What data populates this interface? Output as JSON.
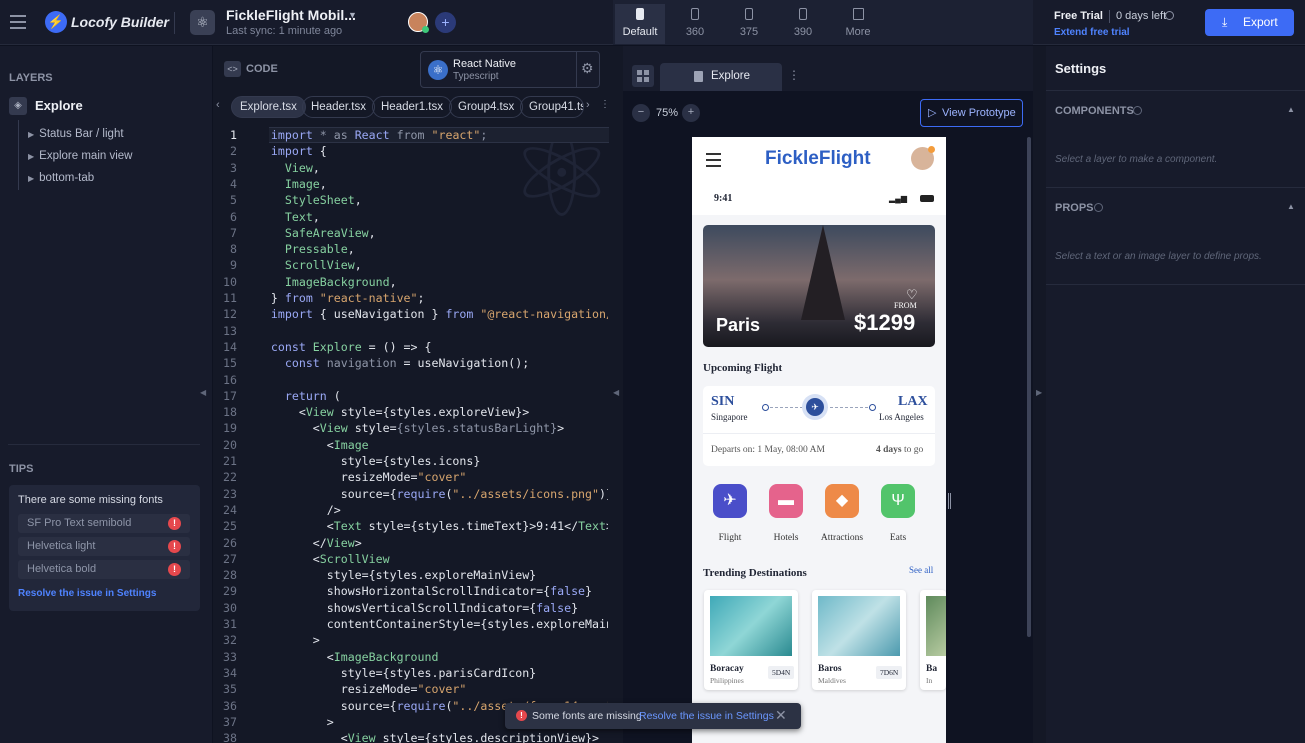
{
  "app": {
    "brand": "Locofy Builder",
    "project_title": "FickleFlight Mobil...",
    "sync_status": "Last sync: 1 minute ago",
    "add_label": "+"
  },
  "devices": [
    {
      "label": "Default"
    },
    {
      "label": "360"
    },
    {
      "label": "375"
    },
    {
      "label": "390"
    },
    {
      "label": "More"
    }
  ],
  "trial": {
    "label": "Free Trial",
    "days": "0 days left",
    "extend": "Extend free trial",
    "export": "Export"
  },
  "layers": {
    "title": "LAYERS",
    "root": "Explore",
    "items": [
      "Status Bar / light",
      "Explore main view",
      "bottom-tab"
    ]
  },
  "tips": {
    "title": "TIPS",
    "heading": "There are some missing fonts",
    "fonts": [
      "SF Pro Text semibold",
      "Helvetica light",
      "Helvetica bold"
    ],
    "resolve": "Resolve the issue in Settings"
  },
  "code": {
    "title": "CODE",
    "framework": "React Native",
    "language": "Typescript",
    "tabs": [
      "Explore.tsx",
      "Header.tsx",
      "Header1.tsx",
      "Group4.tsx",
      "Group41.ts"
    ]
  },
  "preview": {
    "tab": "Explore",
    "zoom": "75%",
    "view_prototype": "View Prototype"
  },
  "phone": {
    "logo": "FickleFlight",
    "time": "9:41",
    "hero_city": "Paris",
    "hero_from": "FROM",
    "hero_price": "$1299",
    "upcoming": "Upcoming Flight",
    "from_code": "SIN",
    "from_city": "Singapore",
    "to_code": "LAX",
    "to_city": "Los Angeles",
    "departs": "Departs on: 1 May, 08:00 AM",
    "days_num": "4 days",
    "days_suffix": "to go",
    "categories": [
      "Flight",
      "Hotels",
      "Attractions",
      "Eats"
    ],
    "trending": "Trending Destinations",
    "see_all": "See all",
    "destinations": [
      {
        "name": "Boracay",
        "country": "Philippines",
        "badge": "5D4N"
      },
      {
        "name": "Baros",
        "country": "Maldives",
        "badge": "7D6N"
      },
      {
        "name": "Ba",
        "country": "In",
        "badge": ""
      }
    ]
  },
  "settings": {
    "title": "Settings",
    "components": "COMPONENTS",
    "components_hint": "Select a layer to make a component.",
    "props": "PROPS",
    "props_hint": "Select a text or an image layer to define props."
  },
  "toast": {
    "message": "Some fonts are missing",
    "link": "Resolve the issue in Settings"
  },
  "colors": {
    "accent": "#3d6bf5",
    "error": "#e5484d",
    "brand_blue": "#2d5fc4"
  }
}
